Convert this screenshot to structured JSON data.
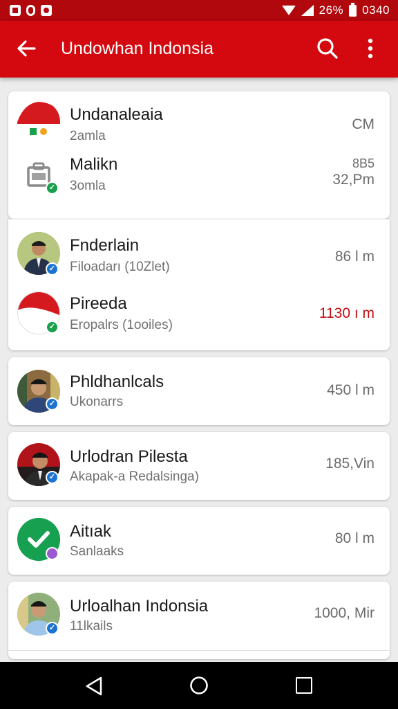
{
  "status_bar": {
    "battery_text": "26%",
    "time": "0340",
    "notification_icons": [
      "gallery-icon",
      "oval-icon",
      "camera-icon"
    ]
  },
  "app_bar": {
    "title": "Undowhan Indonsia",
    "back_icon": "arrow-left-icon",
    "search_icon": "search-icon",
    "menu_icon": "more-vert-icon"
  },
  "cards": [
    {
      "rows": [
        {
          "name": "Undanaleaia",
          "sub": "2amla",
          "time": "CM",
          "badge": "none"
        },
        {
          "name": "Malikn",
          "sub": "3omla",
          "time_top": "8B5",
          "time": "32,Pm",
          "badge": "green"
        }
      ]
    },
    {
      "rows": [
        {
          "name": "Fnderlain",
          "sub": "Filoadarı (10Zlet)",
          "time": "86 l m",
          "badge": "blue"
        },
        {
          "name": "Pireeda",
          "sub": "Eropalrs (1ooiles)",
          "time": "1130 ı m",
          "badge": "green",
          "time_color": "#c40d10"
        }
      ]
    },
    {
      "rows": [
        {
          "name": "Phldhanlcals",
          "sub": "Ukonarrs",
          "time": "450 l m",
          "badge": "blue"
        }
      ]
    },
    {
      "rows": [
        {
          "name": "Urlodran Pilesta",
          "sub": "Akapak-a Redalsinga)",
          "time": "185,Vin",
          "badge": "blue"
        }
      ]
    },
    {
      "rows": [
        {
          "name": "Aitıak",
          "sub": "Sanlaaks",
          "time": "80 l m",
          "badge": "purple"
        }
      ]
    },
    {
      "rows": [
        {
          "name": "Urloalhan Indonsia",
          "sub": "11lkails",
          "time": "1000, Mir",
          "badge": "blue"
        }
      ]
    }
  ],
  "nav_bar": {
    "back": "nav-back-icon",
    "home": "nav-home-icon",
    "recent": "nav-recent-icon"
  },
  "colors": {
    "primary": "#d3090f",
    "status_bar": "#b0080c",
    "accent_red_time": "#c40d10",
    "verified_blue": "#1b74d2",
    "verified_green": "#18a04a"
  }
}
